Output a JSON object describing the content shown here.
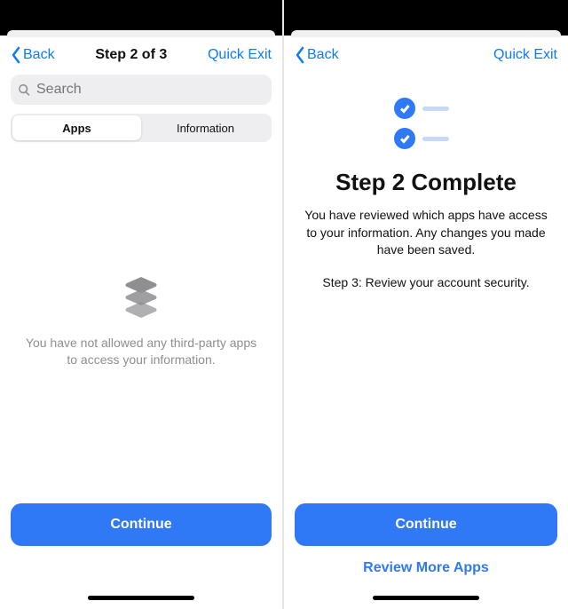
{
  "left": {
    "nav": {
      "back_label": "Back",
      "title": "Step 2 of 3",
      "quick_exit_label": "Quick Exit"
    },
    "search": {
      "placeholder": "Search"
    },
    "segmented": {
      "apps_label": "Apps",
      "info_label": "Information"
    },
    "empty": {
      "message": "You have not allowed any third-party apps to access your information."
    },
    "continue_label": "Continue"
  },
  "right": {
    "nav": {
      "back_label": "Back",
      "quick_exit_label": "Quick Exit"
    },
    "complete": {
      "title": "Step 2 Complete",
      "body": "You have reviewed which apps have access to your information. Any changes you made have been saved.",
      "next_step": "Step 3: Review your account security."
    },
    "continue_label": "Continue",
    "review_more_label": "Review More Apps"
  }
}
